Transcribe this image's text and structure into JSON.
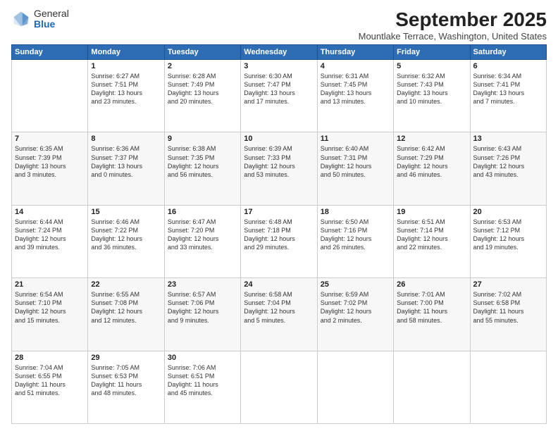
{
  "logo": {
    "general": "General",
    "blue": "Blue"
  },
  "title": "September 2025",
  "location": "Mountlake Terrace, Washington, United States",
  "weekdays": [
    "Sunday",
    "Monday",
    "Tuesday",
    "Wednesday",
    "Thursday",
    "Friday",
    "Saturday"
  ],
  "weeks": [
    [
      {
        "day": "",
        "content": ""
      },
      {
        "day": "1",
        "content": "Sunrise: 6:27 AM\nSunset: 7:51 PM\nDaylight: 13 hours\nand 23 minutes."
      },
      {
        "day": "2",
        "content": "Sunrise: 6:28 AM\nSunset: 7:49 PM\nDaylight: 13 hours\nand 20 minutes."
      },
      {
        "day": "3",
        "content": "Sunrise: 6:30 AM\nSunset: 7:47 PM\nDaylight: 13 hours\nand 17 minutes."
      },
      {
        "day": "4",
        "content": "Sunrise: 6:31 AM\nSunset: 7:45 PM\nDaylight: 13 hours\nand 13 minutes."
      },
      {
        "day": "5",
        "content": "Sunrise: 6:32 AM\nSunset: 7:43 PM\nDaylight: 13 hours\nand 10 minutes."
      },
      {
        "day": "6",
        "content": "Sunrise: 6:34 AM\nSunset: 7:41 PM\nDaylight: 13 hours\nand 7 minutes."
      }
    ],
    [
      {
        "day": "7",
        "content": "Sunrise: 6:35 AM\nSunset: 7:39 PM\nDaylight: 13 hours\nand 3 minutes."
      },
      {
        "day": "8",
        "content": "Sunrise: 6:36 AM\nSunset: 7:37 PM\nDaylight: 13 hours\nand 0 minutes."
      },
      {
        "day": "9",
        "content": "Sunrise: 6:38 AM\nSunset: 7:35 PM\nDaylight: 12 hours\nand 56 minutes."
      },
      {
        "day": "10",
        "content": "Sunrise: 6:39 AM\nSunset: 7:33 PM\nDaylight: 12 hours\nand 53 minutes."
      },
      {
        "day": "11",
        "content": "Sunrise: 6:40 AM\nSunset: 7:31 PM\nDaylight: 12 hours\nand 50 minutes."
      },
      {
        "day": "12",
        "content": "Sunrise: 6:42 AM\nSunset: 7:29 PM\nDaylight: 12 hours\nand 46 minutes."
      },
      {
        "day": "13",
        "content": "Sunrise: 6:43 AM\nSunset: 7:26 PM\nDaylight: 12 hours\nand 43 minutes."
      }
    ],
    [
      {
        "day": "14",
        "content": "Sunrise: 6:44 AM\nSunset: 7:24 PM\nDaylight: 12 hours\nand 39 minutes."
      },
      {
        "day": "15",
        "content": "Sunrise: 6:46 AM\nSunset: 7:22 PM\nDaylight: 12 hours\nand 36 minutes."
      },
      {
        "day": "16",
        "content": "Sunrise: 6:47 AM\nSunset: 7:20 PM\nDaylight: 12 hours\nand 33 minutes."
      },
      {
        "day": "17",
        "content": "Sunrise: 6:48 AM\nSunset: 7:18 PM\nDaylight: 12 hours\nand 29 minutes."
      },
      {
        "day": "18",
        "content": "Sunrise: 6:50 AM\nSunset: 7:16 PM\nDaylight: 12 hours\nand 26 minutes."
      },
      {
        "day": "19",
        "content": "Sunrise: 6:51 AM\nSunset: 7:14 PM\nDaylight: 12 hours\nand 22 minutes."
      },
      {
        "day": "20",
        "content": "Sunrise: 6:53 AM\nSunset: 7:12 PM\nDaylight: 12 hours\nand 19 minutes."
      }
    ],
    [
      {
        "day": "21",
        "content": "Sunrise: 6:54 AM\nSunset: 7:10 PM\nDaylight: 12 hours\nand 15 minutes."
      },
      {
        "day": "22",
        "content": "Sunrise: 6:55 AM\nSunset: 7:08 PM\nDaylight: 12 hours\nand 12 minutes."
      },
      {
        "day": "23",
        "content": "Sunrise: 6:57 AM\nSunset: 7:06 PM\nDaylight: 12 hours\nand 9 minutes."
      },
      {
        "day": "24",
        "content": "Sunrise: 6:58 AM\nSunset: 7:04 PM\nDaylight: 12 hours\nand 5 minutes."
      },
      {
        "day": "25",
        "content": "Sunrise: 6:59 AM\nSunset: 7:02 PM\nDaylight: 12 hours\nand 2 minutes."
      },
      {
        "day": "26",
        "content": "Sunrise: 7:01 AM\nSunset: 7:00 PM\nDaylight: 11 hours\nand 58 minutes."
      },
      {
        "day": "27",
        "content": "Sunrise: 7:02 AM\nSunset: 6:58 PM\nDaylight: 11 hours\nand 55 minutes."
      }
    ],
    [
      {
        "day": "28",
        "content": "Sunrise: 7:04 AM\nSunset: 6:55 PM\nDaylight: 11 hours\nand 51 minutes."
      },
      {
        "day": "29",
        "content": "Sunrise: 7:05 AM\nSunset: 6:53 PM\nDaylight: 11 hours\nand 48 minutes."
      },
      {
        "day": "30",
        "content": "Sunrise: 7:06 AM\nSunset: 6:51 PM\nDaylight: 11 hours\nand 45 minutes."
      },
      {
        "day": "",
        "content": ""
      },
      {
        "day": "",
        "content": ""
      },
      {
        "day": "",
        "content": ""
      },
      {
        "day": "",
        "content": ""
      }
    ]
  ]
}
